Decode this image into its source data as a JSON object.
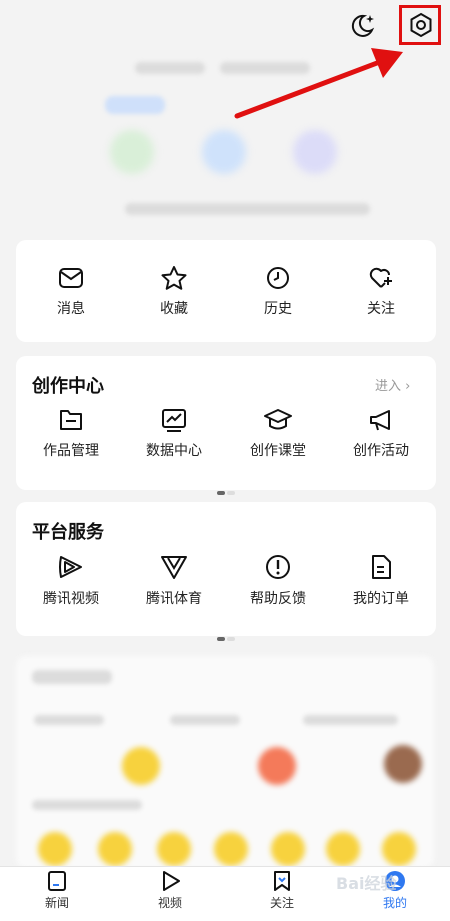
{
  "quick_actions": [
    {
      "label": "消息",
      "icon": "mail-icon"
    },
    {
      "label": "收藏",
      "icon": "star-icon"
    },
    {
      "label": "历史",
      "icon": "clock-icon"
    },
    {
      "label": "关注",
      "icon": "heart-plus-icon"
    }
  ],
  "creation_center": {
    "title": "创作中心",
    "enter_label": "进入",
    "items": [
      {
        "label": "作品管理",
        "icon": "folder-icon"
      },
      {
        "label": "数据中心",
        "icon": "chart-icon"
      },
      {
        "label": "创作课堂",
        "icon": "graduation-cap-icon"
      },
      {
        "label": "创作活动",
        "icon": "megaphone-icon"
      }
    ]
  },
  "platform_services": {
    "title": "平台服务",
    "items": [
      {
        "label": "腾讯视频",
        "icon": "tencent-video-icon"
      },
      {
        "label": "腾讯体育",
        "icon": "tencent-sports-icon"
      },
      {
        "label": "帮助反馈",
        "icon": "help-icon"
      },
      {
        "label": "我的订单",
        "icon": "order-icon"
      }
    ]
  },
  "tabbar": [
    {
      "label": "新闻",
      "icon": "news-icon"
    },
    {
      "label": "视频",
      "icon": "video-play-icon"
    },
    {
      "label": "关注",
      "icon": "follow-icon"
    },
    {
      "label": "我的",
      "icon": "profile-icon",
      "active": true
    }
  ],
  "watermark": "Bai经验",
  "colors": {
    "accent": "#2f78f0",
    "highlight": "#e01010"
  }
}
